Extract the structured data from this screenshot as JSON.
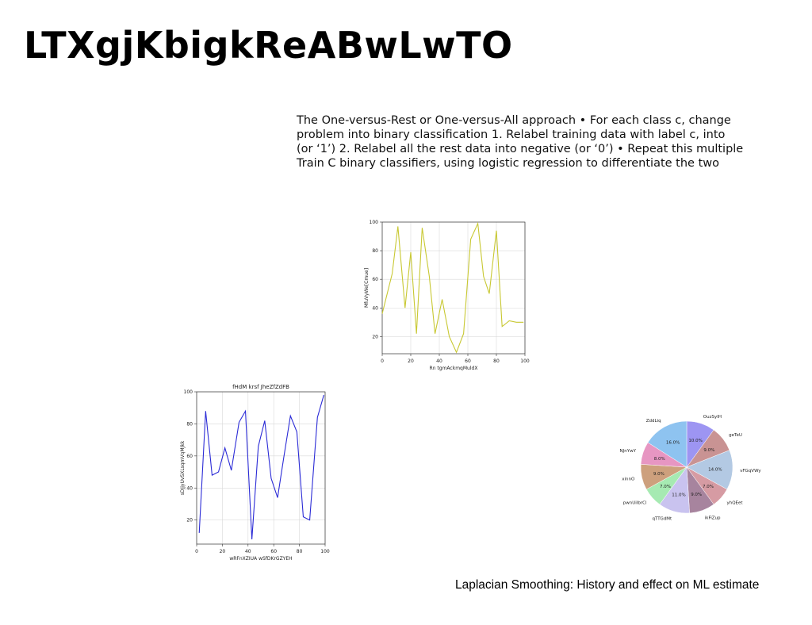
{
  "slide": {
    "title": "LTXgjKbigkReABwLwTO",
    "body_lines": [
      "The One-versus-Rest or One-versus-All approach • For each class c, change",
      "problem into binary classification 1. Relabel training data with label c, into",
      "(or ‘1’) 2. Relabel all the rest data into negative (or ‘0’) • Repeat this multiple",
      "Train C binary classifiers, using logistic regression to differentiate the two"
    ],
    "caption": "Laplacian Smoothing: History and effect on ML estimate"
  },
  "chart_data": [
    {
      "type": "line",
      "title": "",
      "xlabel": "Rn tgmAckmqMuldX",
      "ylabel": "MfuVyWe[Cmue]",
      "xlim": [
        0,
        100
      ],
      "ylim": [
        8,
        100
      ],
      "xticks": [
        0,
        20,
        40,
        60,
        80,
        100
      ],
      "yticks": [
        20,
        40,
        60,
        80,
        100
      ],
      "grid": true,
      "color": "#c8c832",
      "series": [
        {
          "x": [
            0,
            7,
            11,
            16,
            20,
            24,
            28,
            33,
            37,
            42,
            47,
            52,
            57,
            62,
            67,
            71,
            75,
            80,
            84,
            89,
            94,
            99
          ],
          "values": [
            36,
            64,
            97,
            40,
            79,
            22,
            96,
            62,
            22,
            46,
            20,
            9,
            22,
            88,
            99,
            62,
            50,
            94,
            27,
            31,
            30,
            30
          ]
        }
      ]
    },
    {
      "type": "line",
      "title": "fHdM krsf JheZfZdFB",
      "xlabel": "wRFnXZIUA wSfDKrGZYEH",
      "ylabel": "sDJjyUvSXLsqmVqMJkk",
      "xlim": [
        0,
        100
      ],
      "ylim": [
        5,
        100
      ],
      "xticks": [
        0,
        20,
        40,
        60,
        80,
        100
      ],
      "yticks": [
        20,
        40,
        60,
        80,
        100
      ],
      "grid": true,
      "color": "#2b2bd6",
      "series": [
        {
          "x": [
            2,
            7,
            12,
            17,
            22,
            27,
            33,
            38,
            43,
            48,
            53,
            58,
            63,
            68,
            73,
            78,
            83,
            88,
            94,
            99
          ],
          "values": [
            12,
            88,
            48,
            50,
            65,
            51,
            81,
            88,
            8,
            66,
            82,
            46,
            34,
            60,
            85,
            75,
            22,
            20,
            84,
            98
          ]
        }
      ]
    },
    {
      "type": "pie",
      "labels": [
        "OuzSyIH",
        "geTeU",
        "vFGqVWyrE",
        "yhQEet",
        "ikFiZup",
        "qTTGdMt",
        "pwnUiIbrCl",
        "xinnO",
        "NJnYwY",
        "ZddLiq"
      ],
      "values": [
        10.0,
        9.0,
        14.0,
        7.0,
        9.0,
        11.0,
        7.0,
        9.0,
        8.0,
        16.0
      ],
      "value_labels": [
        "10.0%",
        "9.0%",
        "14.0%",
        "7.0%",
        "9.0%",
        "11.0%",
        "7.0%",
        "9.0%",
        "8.0%",
        "16.0%"
      ],
      "colors": [
        "#9d95f2",
        "#c99393",
        "#b3c9e3",
        "#d69ba3",
        "#a7849e",
        "#c9c3ef",
        "#a6eab2",
        "#cda07d",
        "#e796c2",
        "#8ec3f0"
      ]
    }
  ]
}
